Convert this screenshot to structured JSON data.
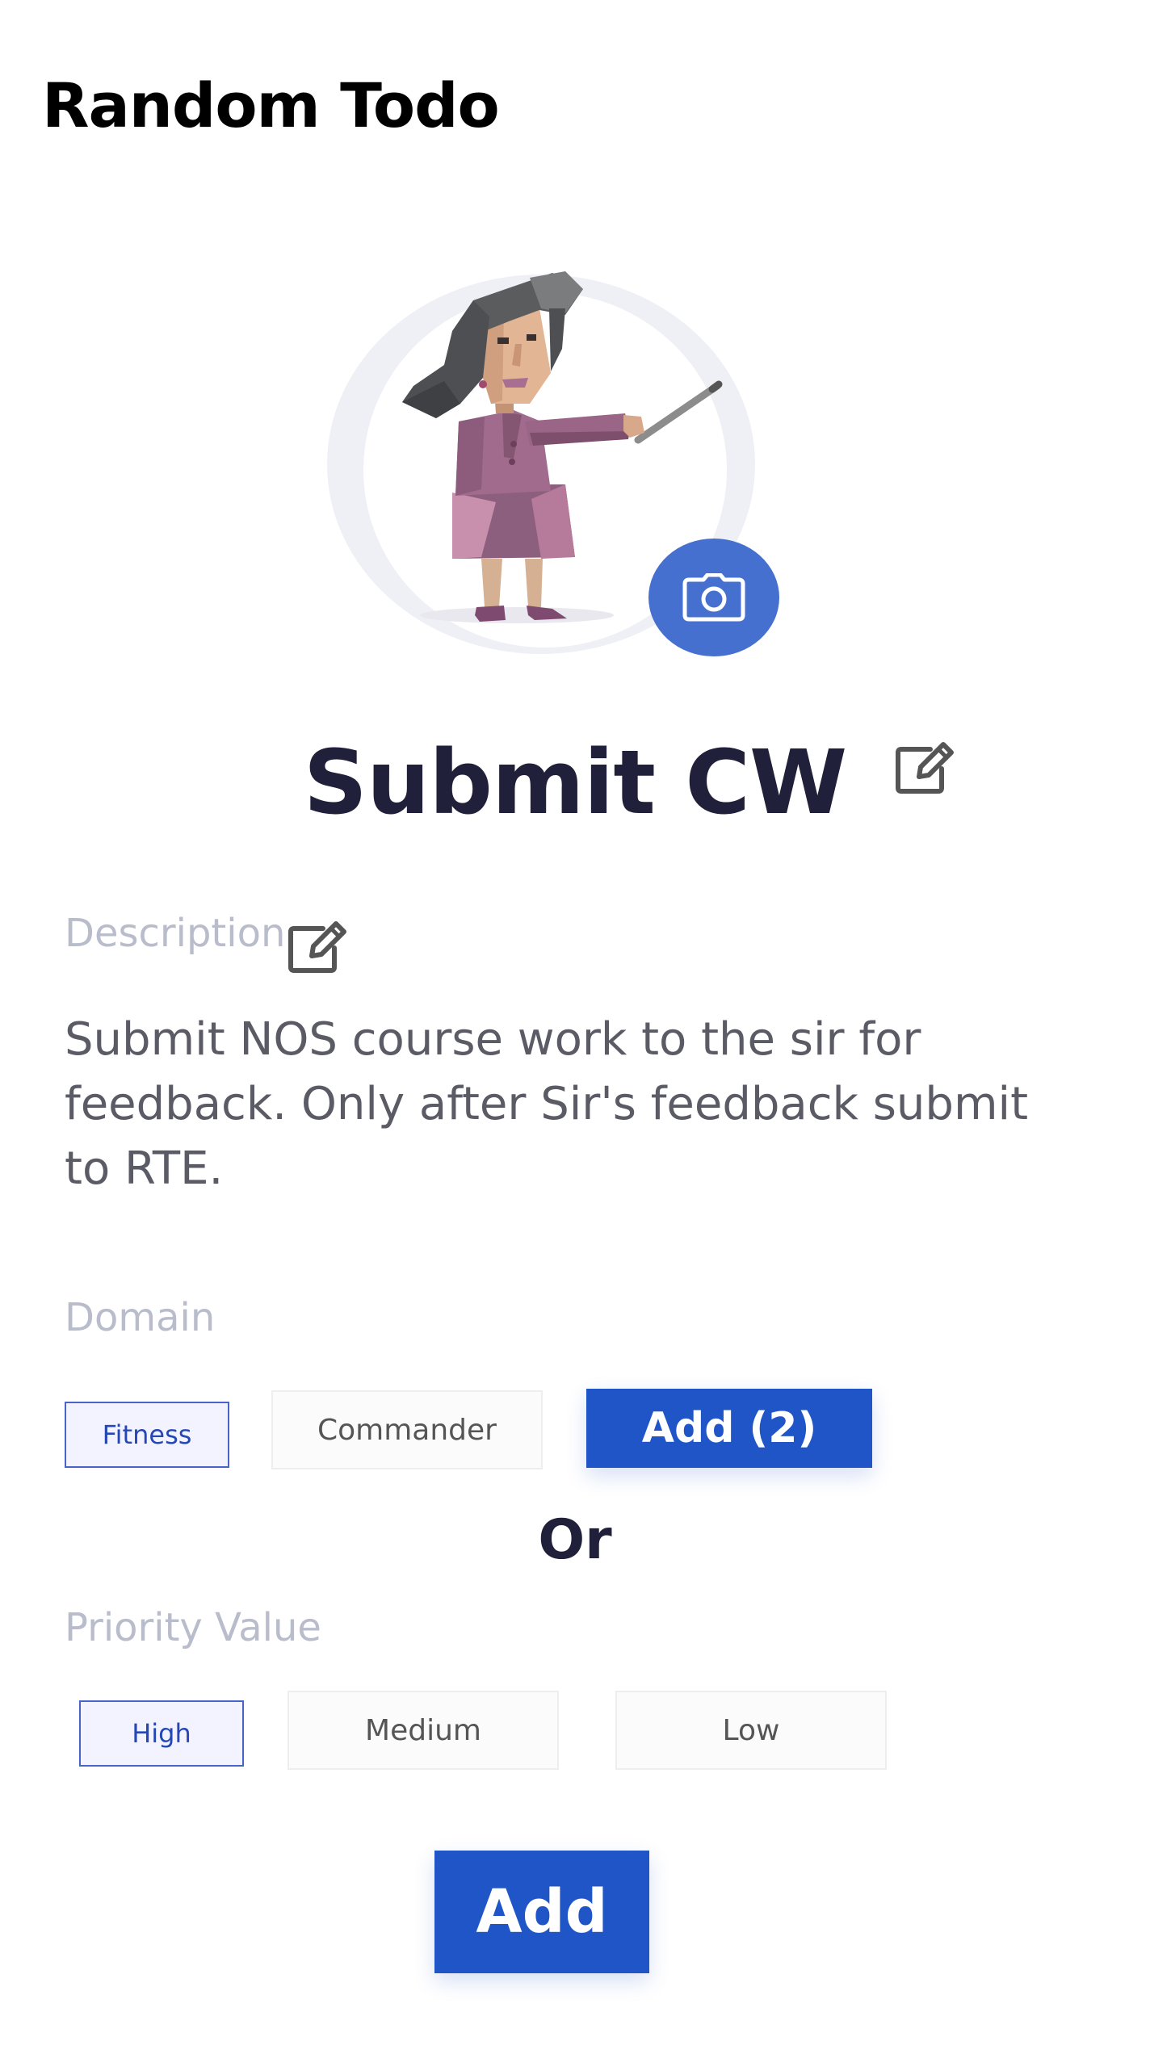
{
  "app": {
    "title": "Random Todo"
  },
  "task": {
    "title": "Submit CW",
    "description_label": "Description",
    "description": "Submit NOS course work to the sir for feedback. Only after Sir's feedback submit to RTE."
  },
  "domain": {
    "label": "Domain",
    "chips": [
      {
        "label": "Fitness",
        "selected": true
      },
      {
        "label": "Commander",
        "selected": false
      }
    ],
    "add_button": "Add (2)"
  },
  "separator": "Or",
  "priority": {
    "label": "Priority Value",
    "chips": [
      {
        "label": "High",
        "selected": true
      },
      {
        "label": "Medium",
        "selected": false
      },
      {
        "label": "Low",
        "selected": false
      }
    ]
  },
  "submit_button": "Add",
  "icons": {
    "avatar_action": "camera-icon",
    "title_edit": "edit-icon",
    "description_edit": "edit-icon"
  },
  "colors": {
    "accent": "#2055c8",
    "camera_button": "#4570cf",
    "title_text": "#20203a",
    "label_text": "#b9bccb",
    "selected_chip_border": "#4a63c8"
  }
}
